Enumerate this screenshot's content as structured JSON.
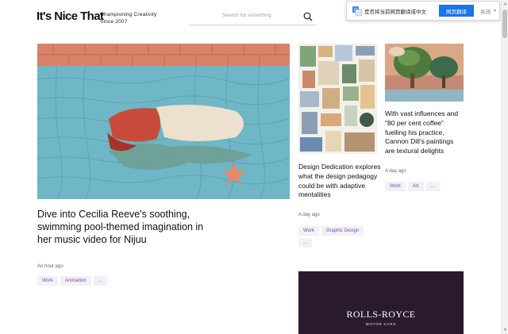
{
  "header": {
    "logo": "It's Nice That",
    "tagline_line1": "Championing Creativity",
    "tagline_line2": "Since 2007",
    "search_placeholder": "Search for something"
  },
  "translate_bar": {
    "message": "是否将当前网页翻译成中文",
    "button_label": "网页翻译",
    "close_label": "关闭"
  },
  "main_article": {
    "title": "Dive into Cecilia Reeve's soothing, swimming pool-themed imagination in her music video for Nijuu",
    "time": "An hour ago",
    "tags": [
      "Work",
      "Animation",
      "..."
    ]
  },
  "article_2": {
    "title": "Design Dedication explores what the design pedagogy could be with adaptive mentalities",
    "time": "A day ago",
    "tags": [
      "Work",
      "Graphic Design",
      "..."
    ]
  },
  "article_3": {
    "title": "With vast influences and \"80 per cent coffee\" fuelling his practice, Cannon Dill's paintings are textural delights",
    "time": "A day ago",
    "tags": [
      "Work",
      "Art",
      "..."
    ]
  },
  "ad": {
    "brand": "ROLLS-ROYCE",
    "subline": "MOTOR CARS"
  },
  "colors": {
    "tag_text": "#7a4db0",
    "tag_bg": "#f3f0f6",
    "translate_button": "#1a73e8",
    "ad_bg": "#2a1a30"
  }
}
